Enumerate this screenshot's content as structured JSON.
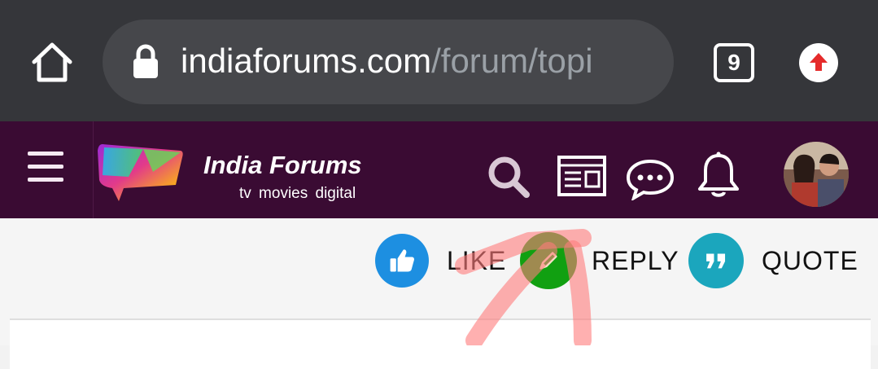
{
  "browser": {
    "url_host": "indiaforums.com",
    "url_path": "/forum/topi",
    "tab_count": "9",
    "icons": [
      "home-icon",
      "lock-icon",
      "tab-switcher-icon",
      "update-icon"
    ]
  },
  "site_header": {
    "brand": "India Forums",
    "tagline": "tv movies digital",
    "icons": [
      "menu-icon",
      "search-icon",
      "news-icon",
      "chat-icon",
      "bell-icon",
      "avatar"
    ]
  },
  "actions": {
    "like": "LIKE",
    "reply": "REPLY",
    "quote": "QUOTE"
  },
  "colors": {
    "chrome_bg": "#35363a",
    "header_bg": "#3a0b33",
    "like": "#1d8fe1",
    "reply": "#11a011",
    "quote": "#1ba6bd",
    "annotation": "#ff7070"
  }
}
